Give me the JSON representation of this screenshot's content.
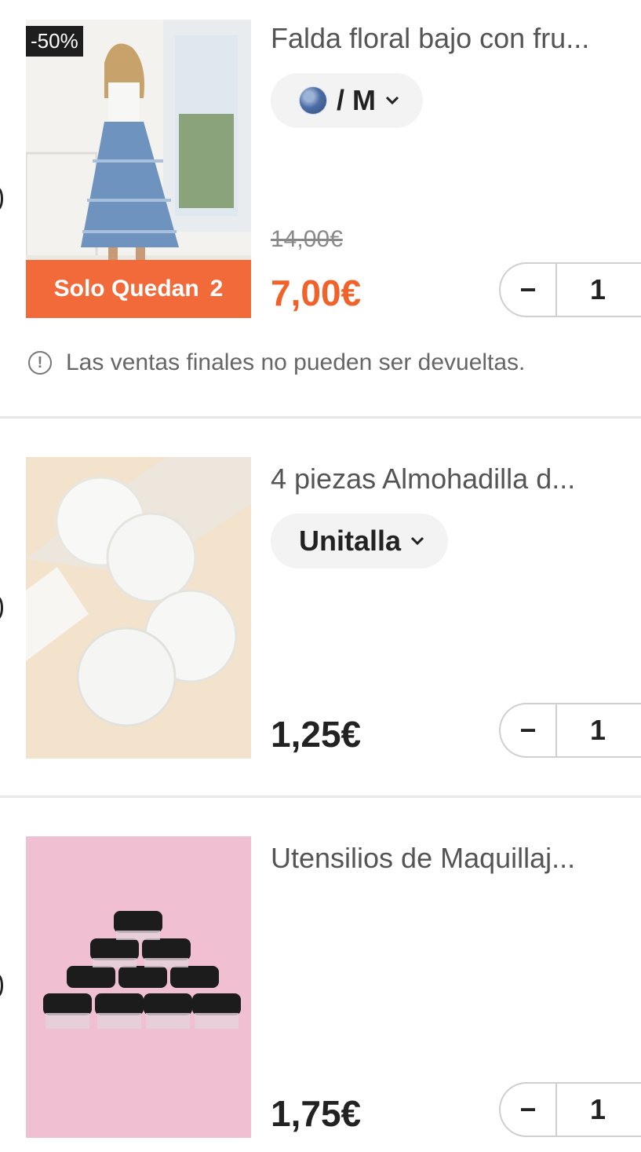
{
  "items": [
    {
      "title": "Falda floral bajo con fru...",
      "variant": "/ M",
      "variant_swatch": "blue-floral",
      "discount_badge": "-50%",
      "stock_text": "Solo Quedan",
      "stock_count": "2",
      "old_price": "14,00€",
      "price": "7,00€",
      "quantity": "1",
      "notice": "Las ventas finales no pueden ser devueltas."
    },
    {
      "title": "4 piezas Almohadilla d...",
      "variant": "Unitalla",
      "price": "1,25€",
      "quantity": "1"
    },
    {
      "title": "Utensilios de Maquillaj...",
      "price": "1,75€",
      "quantity": "1"
    }
  ],
  "icons": {
    "minus": "−",
    "chevron": "chevron-down-icon",
    "info": "!"
  },
  "colors": {
    "sale_price": "#f0622a",
    "stock_bar": "#f26a3a"
  }
}
